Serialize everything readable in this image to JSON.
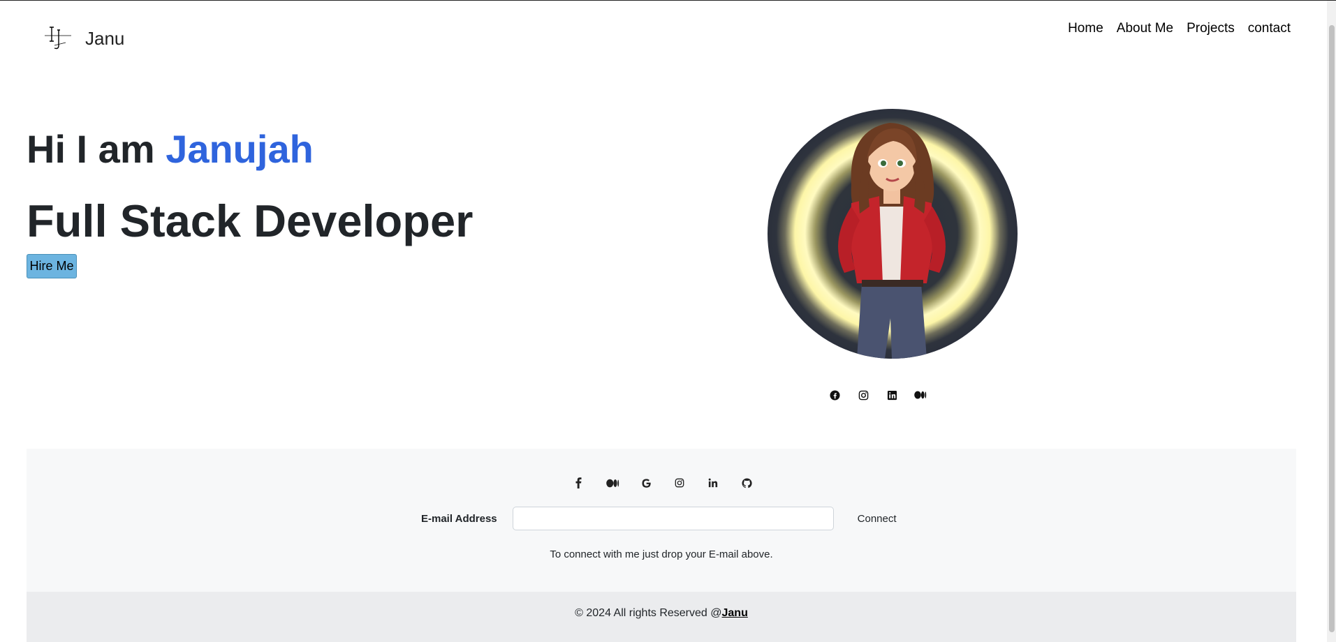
{
  "header": {
    "brand_name": "Janu",
    "nav": [
      "Home",
      "About Me",
      "Projects",
      "contact"
    ]
  },
  "hero": {
    "greeting": "Hi I am",
    "name": "Janujah",
    "role": "Full Stack Developer",
    "hire_label": "Hire Me",
    "social_icons": [
      "facebook-icon",
      "instagram-icon",
      "linkedin-icon",
      "medium-icon"
    ]
  },
  "footer": {
    "social_icons": [
      "facebook-icon",
      "medium-icon",
      "google-icon",
      "instagram-icon",
      "linkedin-icon",
      "github-icon"
    ],
    "email_label": "E-mail Address",
    "email_value": "",
    "connect_label": "Connect",
    "hint": "To connect with me just drop your E-mail above.",
    "copyright_prefix": "© 2024 All rights Reserved @",
    "copyright_link": "Janu"
  },
  "colors": {
    "accent_name": "#2f64dd",
    "hire_button": "#6cb4e0",
    "footer_bg": "#f7f8f9",
    "copyright_bg": "#ebecee"
  }
}
